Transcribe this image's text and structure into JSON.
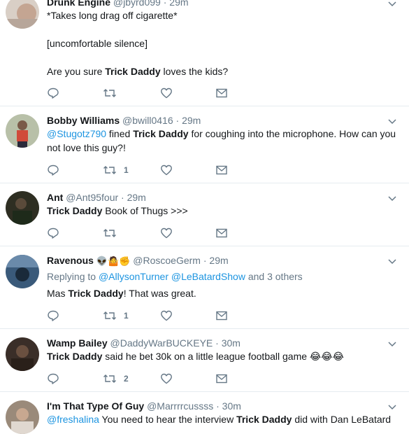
{
  "tweets": [
    {
      "name": "Drunk Engine",
      "handle": "@jbyrd099",
      "time": "29m",
      "emoji": "",
      "reply_prefix": "",
      "reply_targets": [],
      "reply_suffix": "",
      "lines": [
        "*Takes long drag off cigarette*",
        "",
        "[uncomfortable silence]",
        "",
        "Are you sure Trick Daddy loves the kids?"
      ],
      "retweets": "",
      "avatar_color": "#c9b8a8"
    },
    {
      "name": "Bobby Williams",
      "handle": "@bwill0416",
      "time": "29m",
      "emoji": "",
      "text_mention": "@Stugotz790",
      "text": " fined Trick Daddy for coughing into the microphone. How can you not love this guy?!",
      "retweets": "1",
      "avatar_color": "#d04a3a"
    },
    {
      "name": "Ant",
      "handle": "@Ant95four",
      "time": "29m",
      "emoji": "",
      "text": "Trick Daddy Book of Thugs >>>",
      "retweets": "",
      "avatar_color": "#3a3a2a"
    },
    {
      "name": "Ravenous",
      "handle": "@RoscoeGerm",
      "time": "29m",
      "emoji": "👽🤷✊",
      "reply_prefix": "Replying to ",
      "reply_targets": [
        "@AllysonTurner",
        "@LeBatardShow"
      ],
      "reply_suffix": " and 3 others",
      "text": "Mas Trick Daddy! That was great.",
      "retweets": "1",
      "avatar_color": "#4a6a8a"
    },
    {
      "name": "Wamp Bailey",
      "handle": "@DaddyWarBUCKEYE",
      "time": "30m",
      "emoji": "",
      "text": "Trick Daddy said he bet 30k on a little league football game 😂😂😂",
      "retweets": "2",
      "avatar_color": "#4a3a30"
    },
    {
      "name": "I'm That Type Of Guy",
      "handle": "@Marrrrcussss",
      "time": "30m",
      "emoji": "",
      "text_mention": "@freshalina",
      "text": " You need to hear the interview Trick Daddy did with Dan LeBatard",
      "retweets": "",
      "avatar_color": "#8a7a6a"
    }
  ],
  "dot": "·",
  "highlight_term": "Trick Daddy",
  "icons": {
    "reply": "reply-icon",
    "retweet": "retweet-icon",
    "like": "heart-icon",
    "dm": "envelope-icon",
    "more": "chevron-down-icon"
  },
  "colors": {
    "text": "#14171a",
    "muted": "#657786",
    "link": "#1c94e0",
    "divider": "#e6ecf0"
  }
}
